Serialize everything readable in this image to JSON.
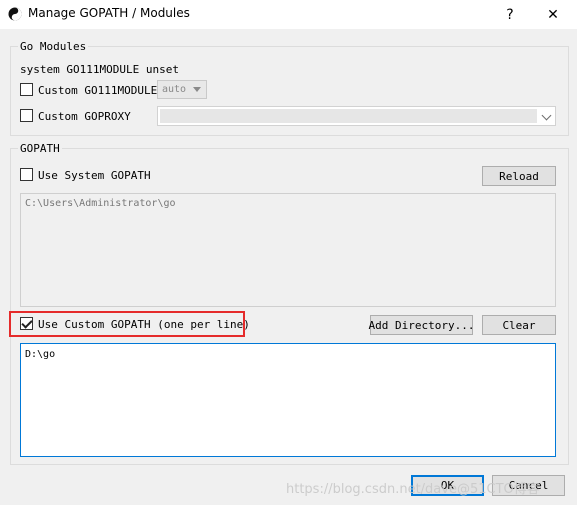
{
  "window": {
    "title": "Manage GOPATH / Modules",
    "help_label": "?",
    "close_label": "✕"
  },
  "go_modules": {
    "group_title": "Go Modules",
    "status_text": "system GO111MODULE unset",
    "custom_module": {
      "label": "Custom GO111MODULE",
      "checked": false,
      "value": "auto"
    },
    "custom_proxy": {
      "label": "Custom GOPROXY",
      "checked": false,
      "value": ""
    }
  },
  "gopath": {
    "group_title": "GOPATH",
    "use_system": {
      "label": "Use System GOPATH",
      "checked": false
    },
    "reload_label": "Reload",
    "system_path": "C:\\Users\\Administrator\\go",
    "use_custom": {
      "label": "Use Custom GOPATH (one per line)",
      "checked": true
    },
    "add_directory_label": "Add Directory...",
    "clear_label": "Clear",
    "custom_paths": "D:\\go"
  },
  "footer": {
    "ok_label": "OK",
    "cancel_label": "Cancel"
  },
  "watermark": "https://blog.csdn.net/dave@51CTO博客",
  "colors": {
    "highlight": "#e52b2b",
    "focus": "#0078d7"
  }
}
